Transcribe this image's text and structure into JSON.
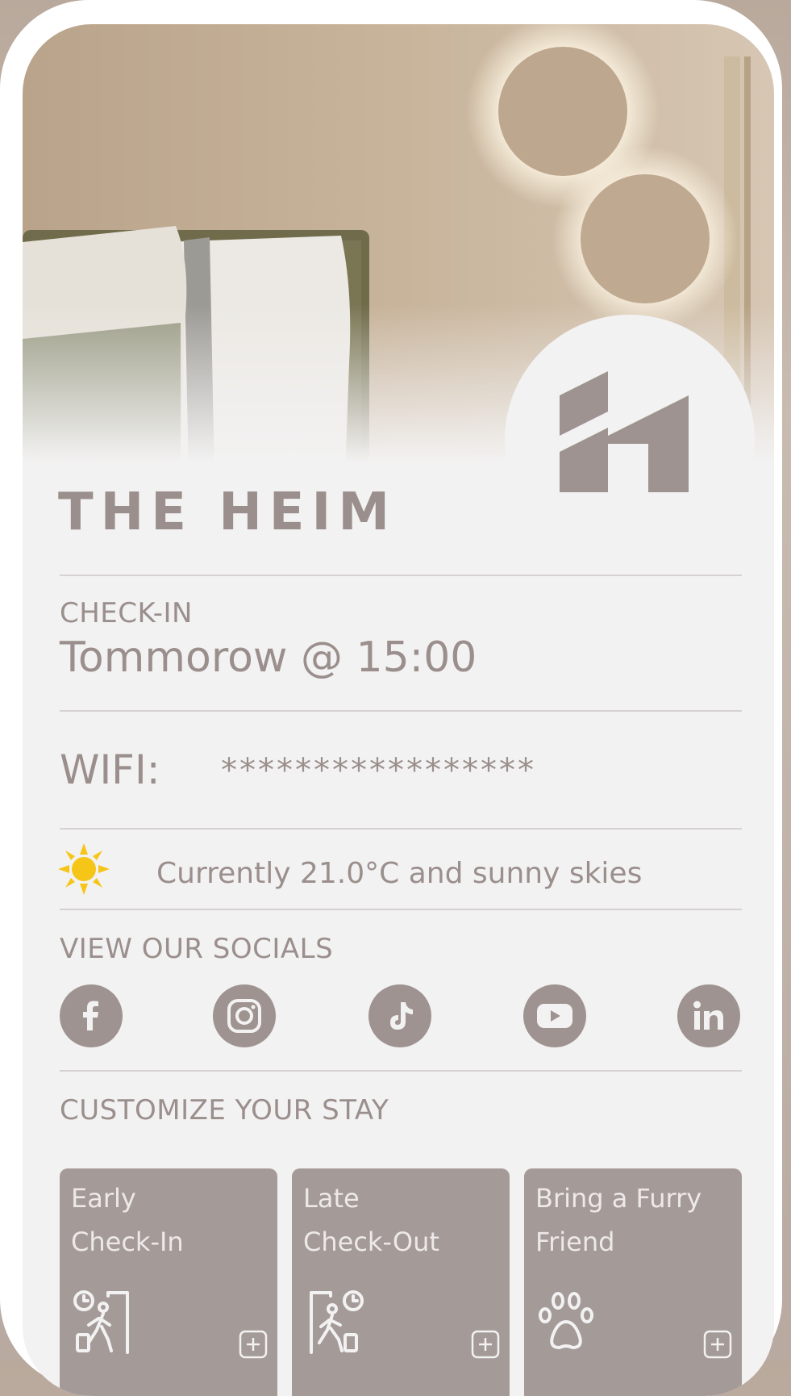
{
  "brand": {
    "name": "THE HEIM"
  },
  "checkin": {
    "label": "CHECK-IN",
    "value": "Tommorow @ 15:00"
  },
  "wifi": {
    "label": "WIFI:",
    "password_masked": "*****************"
  },
  "weather": {
    "icon": "sun-icon",
    "text": "Currently 21.0°C and sunny skies"
  },
  "socials": {
    "heading": "VIEW OUR SOCIALS",
    "items": [
      {
        "name": "facebook",
        "icon": "facebook-icon"
      },
      {
        "name": "instagram",
        "icon": "instagram-icon"
      },
      {
        "name": "tiktok",
        "icon": "tiktok-icon"
      },
      {
        "name": "youtube",
        "icon": "youtube-icon"
      },
      {
        "name": "linkedin",
        "icon": "linkedin-icon"
      }
    ]
  },
  "customize": {
    "heading": "CUSTOMIZE YOUR STAY",
    "cards": [
      {
        "line1": "Early",
        "line2": "Check-In",
        "icon": "early-check-in-icon"
      },
      {
        "line1": "Late",
        "line2": "Check-Out",
        "icon": "late-check-out-icon"
      },
      {
        "line1": "Bring a Furry",
        "line2": "Friend",
        "icon": "paw-icon"
      }
    ]
  },
  "colors": {
    "text": "#9a8f8c",
    "card_bg": "#a49a98",
    "social_bg": "#9e9390",
    "sun": "#f5c518"
  }
}
